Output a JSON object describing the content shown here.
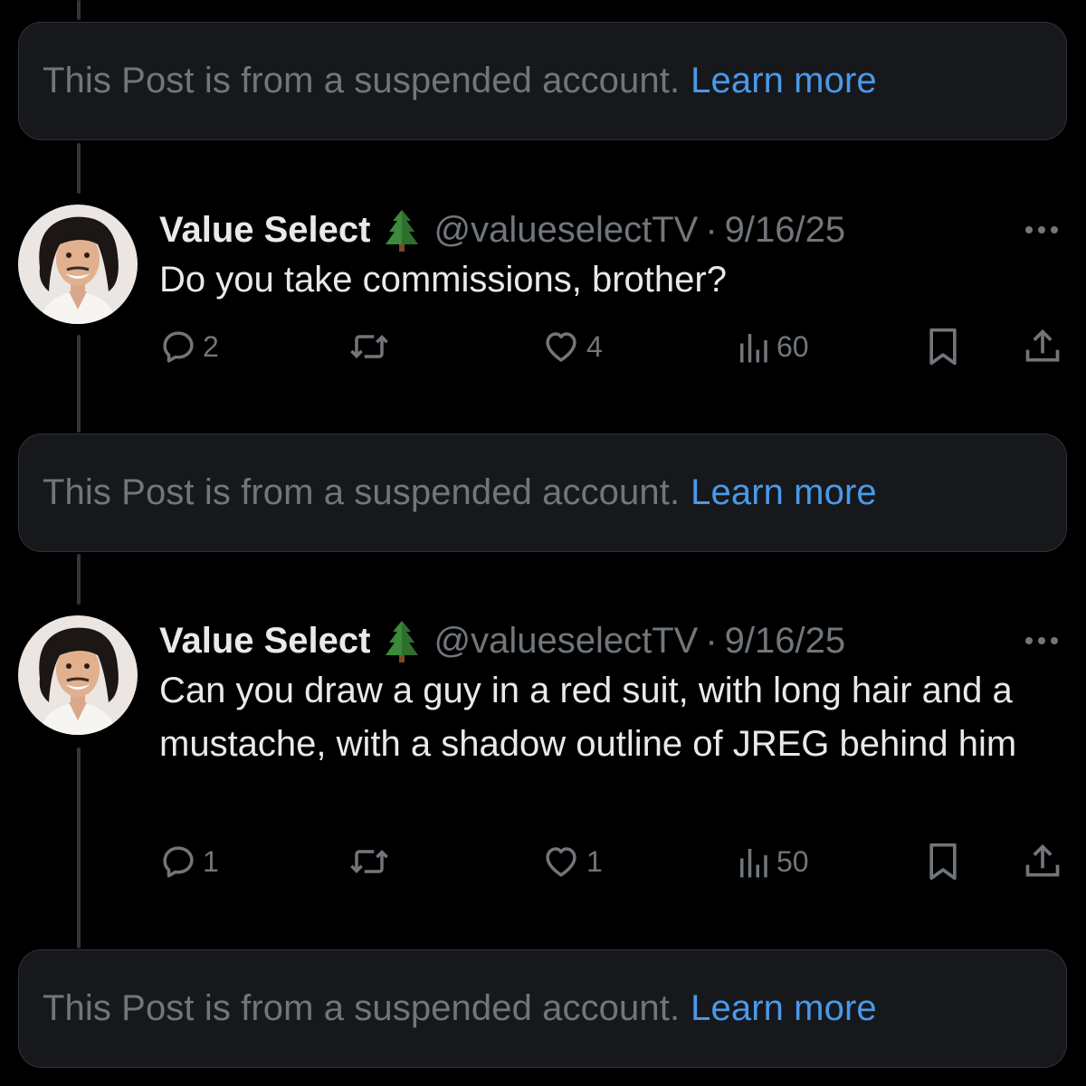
{
  "suspended_notice": {
    "text": "This Post is from a suspended account.",
    "link_label": "Learn more"
  },
  "tweets": [
    {
      "display_name": "Value Select",
      "badge_emoji": "evergreen-tree-icon",
      "handle": "@valueselectTV",
      "separator": "·",
      "date": "9/16/25",
      "text": "Do you take commissions, brother?",
      "replies": "2",
      "reposts": "",
      "likes": "4",
      "views": "60"
    },
    {
      "display_name": "Value Select",
      "badge_emoji": "evergreen-tree-icon",
      "handle": "@valueselectTV",
      "separator": "·",
      "date": "9/16/25",
      "text": "Can you draw a guy in a red suit, with long hair and a mustache, with a shadow outline of JREG behind him",
      "replies": "1",
      "reposts": "",
      "likes": "1",
      "views": "50"
    }
  ],
  "colors": {
    "background": "#000000",
    "card_background": "#16181c",
    "primary_text": "#e7e9ea",
    "secondary_text": "#71767b",
    "link": "#4a99e9",
    "thread_line": "#333639"
  }
}
